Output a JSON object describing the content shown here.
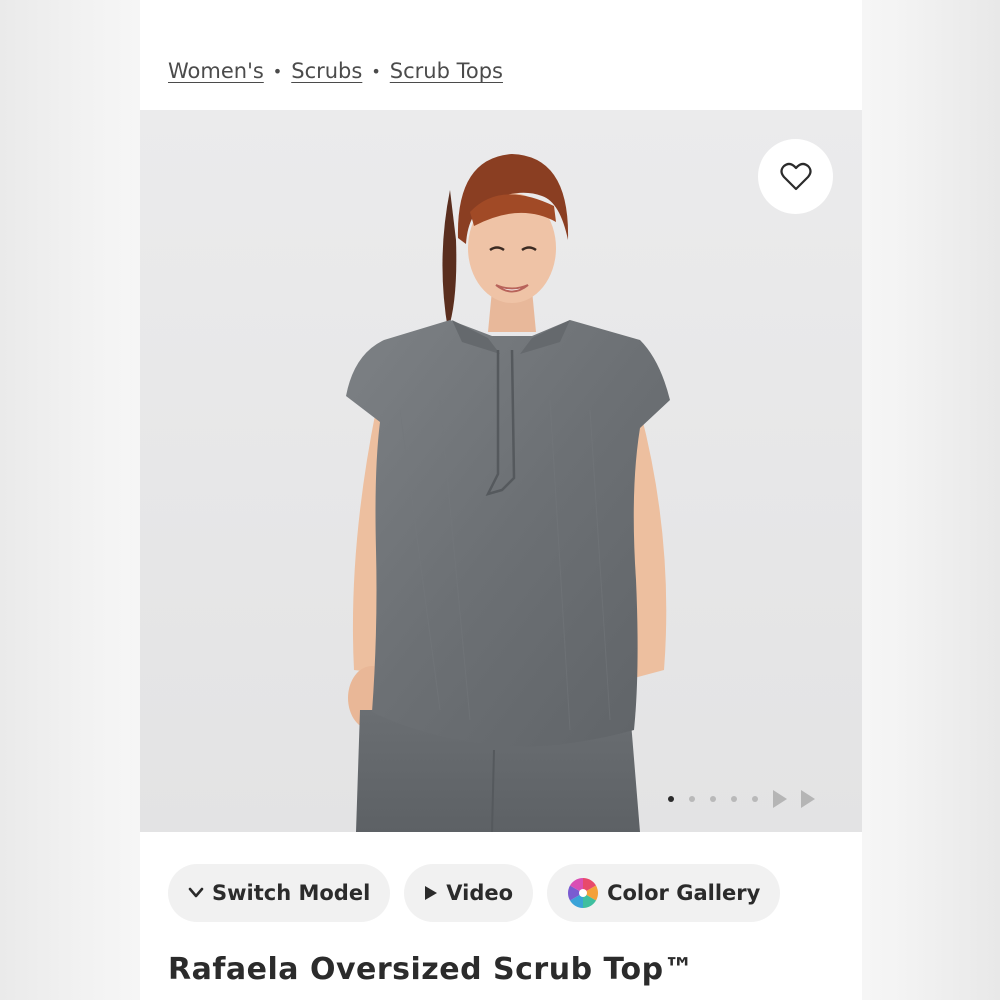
{
  "breadcrumb": {
    "items": [
      "Women's",
      "Scrubs",
      "Scrub Tops"
    ],
    "separator": "•"
  },
  "hero": {
    "image_alt": "Model wearing gray oversized scrub top",
    "favorite_icon": "heart-icon",
    "carousel": {
      "total_dots": 5,
      "active_index": 0,
      "next_icons": [
        "play-icon",
        "play-icon"
      ]
    }
  },
  "actions": {
    "switch_model": "Switch Model",
    "video": "Video",
    "color_gallery": "Color Gallery"
  },
  "product": {
    "title": "Rafaela Oversized Scrub Top™"
  },
  "colors": {
    "page_bg": "#ffffff",
    "hero_bg": "#e9e9ea",
    "chip_bg": "#f1f1f1",
    "text": "#2b2b2b",
    "scrub_gray": "#6e7276"
  }
}
